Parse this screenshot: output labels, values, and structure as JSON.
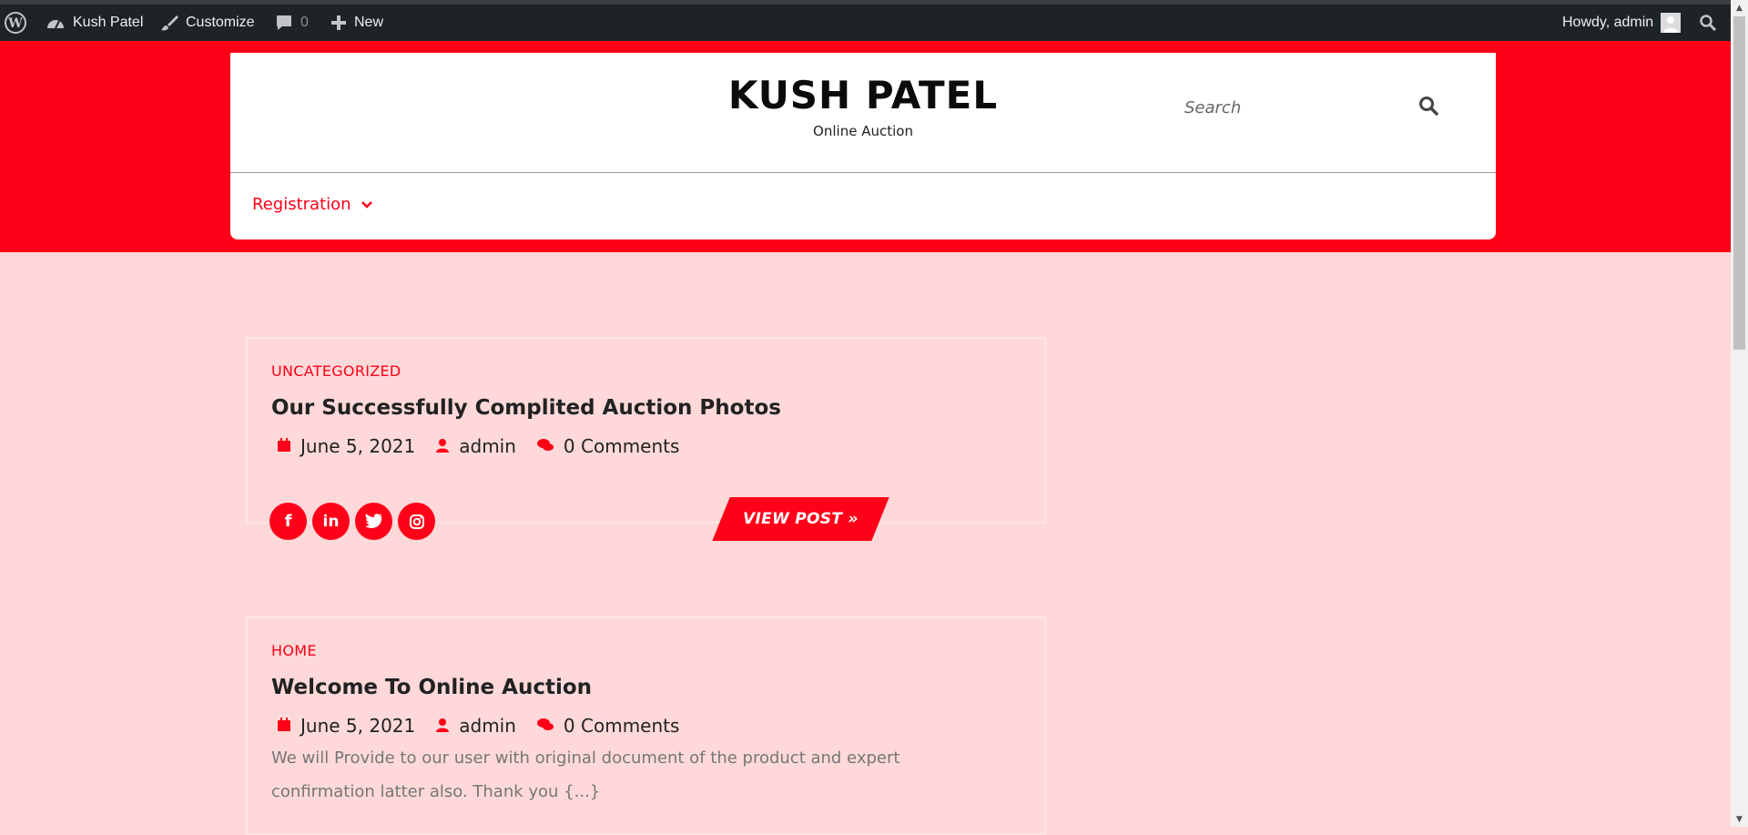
{
  "colors": {
    "accent": "#ff0018",
    "admin_bar": "#1d2327",
    "page_bg": "#ffd9d9"
  },
  "adminbar": {
    "site_name": "Kush Patel",
    "customize": "Customize",
    "comments_count": "0",
    "new_label": "New",
    "greeting": "Howdy, admin"
  },
  "header": {
    "site_title": "KUSH PATEL",
    "tagline": "Online Auction",
    "search_placeholder": "Search",
    "nav": [
      {
        "label": "Registration",
        "has_dropdown": true
      }
    ]
  },
  "posts": [
    {
      "category": "UNCATEGORIZED",
      "title": "Our Successfully Complited Auction Photos",
      "date": "June 5, 2021",
      "author": "admin",
      "comments": "0 Comments",
      "socials": [
        "facebook-icon",
        "linkedin-icon",
        "twitter-icon",
        "instagram-icon"
      ],
      "button_label": "VIEW POST »"
    },
    {
      "category": "HOME",
      "title": "Welcome To Online Auction",
      "date": "June 5, 2021",
      "author": "admin",
      "comments": "0 Comments",
      "excerpt": "We will Provide to our user with original document of the product and expert confirmation latter also. Thank you {...}"
    }
  ]
}
